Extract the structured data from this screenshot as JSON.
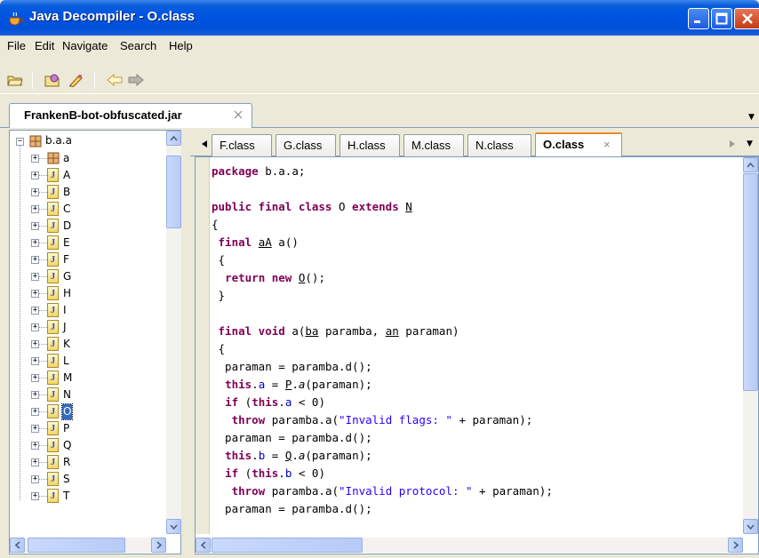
{
  "window": {
    "title": "Java Decompiler - O.class",
    "icon": "coffee-cup-icon"
  },
  "menu": [
    "File",
    "Edit",
    "Navigate",
    "Search",
    "Help"
  ],
  "toolbar": {
    "icons": [
      "open-folder-icon",
      "browse-icon",
      "edit-icon",
      "back-icon",
      "forward-icon"
    ]
  },
  "file_tab": {
    "label": "FrankenB-bot-obfuscated.jar"
  },
  "tree": {
    "root": "b.a.a",
    "items": [
      {
        "label": "a",
        "kind": "package"
      },
      {
        "label": "A",
        "kind": "class"
      },
      {
        "label": "B",
        "kind": "class"
      },
      {
        "label": "C",
        "kind": "class"
      },
      {
        "label": "D",
        "kind": "class"
      },
      {
        "label": "E",
        "kind": "class"
      },
      {
        "label": "F",
        "kind": "class"
      },
      {
        "label": "G",
        "kind": "class"
      },
      {
        "label": "H",
        "kind": "class"
      },
      {
        "label": "I",
        "kind": "class"
      },
      {
        "label": "J",
        "kind": "class"
      },
      {
        "label": "K",
        "kind": "class"
      },
      {
        "label": "L",
        "kind": "class"
      },
      {
        "label": "M",
        "kind": "class"
      },
      {
        "label": "N",
        "kind": "class"
      },
      {
        "label": "O",
        "kind": "class",
        "selected": true
      },
      {
        "label": "P",
        "kind": "class"
      },
      {
        "label": "Q",
        "kind": "class"
      },
      {
        "label": "R",
        "kind": "class"
      },
      {
        "label": "S",
        "kind": "class"
      },
      {
        "label": "T",
        "kind": "class"
      }
    ]
  },
  "code_tabs": [
    {
      "label": "F.class"
    },
    {
      "label": "G.class"
    },
    {
      "label": "H.class"
    },
    {
      "label": "M.class"
    },
    {
      "label": "N.class"
    },
    {
      "label": "O.class",
      "active": true
    }
  ],
  "code_lines": [
    [
      [
        "kw",
        "package"
      ],
      [
        "",
        "  b.a.a;"
      ]
    ],
    [],
    [
      [
        "kw",
        "public final class"
      ],
      [
        "",
        "  O "
      ],
      [
        "kw",
        "extends"
      ],
      [
        "",
        "  "
      ],
      [
        "tu",
        "N"
      ]
    ],
    [
      [
        "",
        "{"
      ]
    ],
    [
      [
        "",
        "  "
      ],
      [
        "kw",
        "final"
      ],
      [
        "",
        "  "
      ],
      [
        "tu",
        "aA"
      ],
      [
        "",
        "  a()"
      ]
    ],
    [
      [
        "",
        "  {"
      ]
    ],
    [
      [
        "",
        "    "
      ],
      [
        "kw",
        "return new"
      ],
      [
        "",
        "  "
      ],
      [
        "tu",
        "O"
      ],
      [
        "",
        "();"
      ]
    ],
    [
      [
        "",
        "  }"
      ]
    ],
    [],
    [
      [
        "",
        "  "
      ],
      [
        "kw",
        "final void"
      ],
      [
        "",
        "  a("
      ],
      [
        "tu",
        "ba"
      ],
      [
        "",
        "  paramba, "
      ],
      [
        "tu",
        "an"
      ],
      [
        "",
        "  paraman)"
      ]
    ],
    [
      [
        "",
        "  {"
      ]
    ],
    [
      [
        "",
        "    paraman = paramba.d();"
      ]
    ],
    [
      [
        "",
        "    "
      ],
      [
        "kw",
        "this"
      ],
      [
        "",
        "."
      ],
      [
        "fn",
        "a"
      ],
      [
        "",
        "  = "
      ],
      [
        "tu",
        "P"
      ],
      [
        "",
        "."
      ],
      [
        "it",
        "a"
      ],
      [
        "",
        "(paraman);"
      ]
    ],
    [
      [
        "",
        "    "
      ],
      [
        "kw",
        "if"
      ],
      [
        "",
        "  ("
      ],
      [
        "kw",
        "this"
      ],
      [
        "",
        "."
      ],
      [
        "fn",
        "a"
      ],
      [
        "",
        "  < 0)"
      ]
    ],
    [
      [
        "",
        "      "
      ],
      [
        "kw",
        "throw"
      ],
      [
        "",
        "  paramba.a("
      ],
      [
        "str",
        "\"Invalid flags: \""
      ],
      [
        "",
        "  + paraman);"
      ]
    ],
    [
      [
        "",
        "    paraman = paramba.d();"
      ]
    ],
    [
      [
        "",
        "    "
      ],
      [
        "kw",
        "this"
      ],
      [
        "",
        "."
      ],
      [
        "fn",
        "b"
      ],
      [
        "",
        "  = "
      ],
      [
        "tu",
        "Q"
      ],
      [
        "",
        "."
      ],
      [
        "it",
        "a"
      ],
      [
        "",
        "(paraman);"
      ]
    ],
    [
      [
        "",
        "    "
      ],
      [
        "kw",
        "if"
      ],
      [
        "",
        "  ("
      ],
      [
        "kw",
        "this"
      ],
      [
        "",
        "."
      ],
      [
        "fn",
        "b"
      ],
      [
        "",
        "  < 0)"
      ]
    ],
    [
      [
        "",
        "      "
      ],
      [
        "kw",
        "throw"
      ],
      [
        "",
        "  paramba.a("
      ],
      [
        "str",
        "\"Invalid protocol: \""
      ],
      [
        "",
        "  + paraman);"
      ]
    ],
    [
      [
        "",
        "    paraman = paramba.d();"
      ]
    ]
  ]
}
